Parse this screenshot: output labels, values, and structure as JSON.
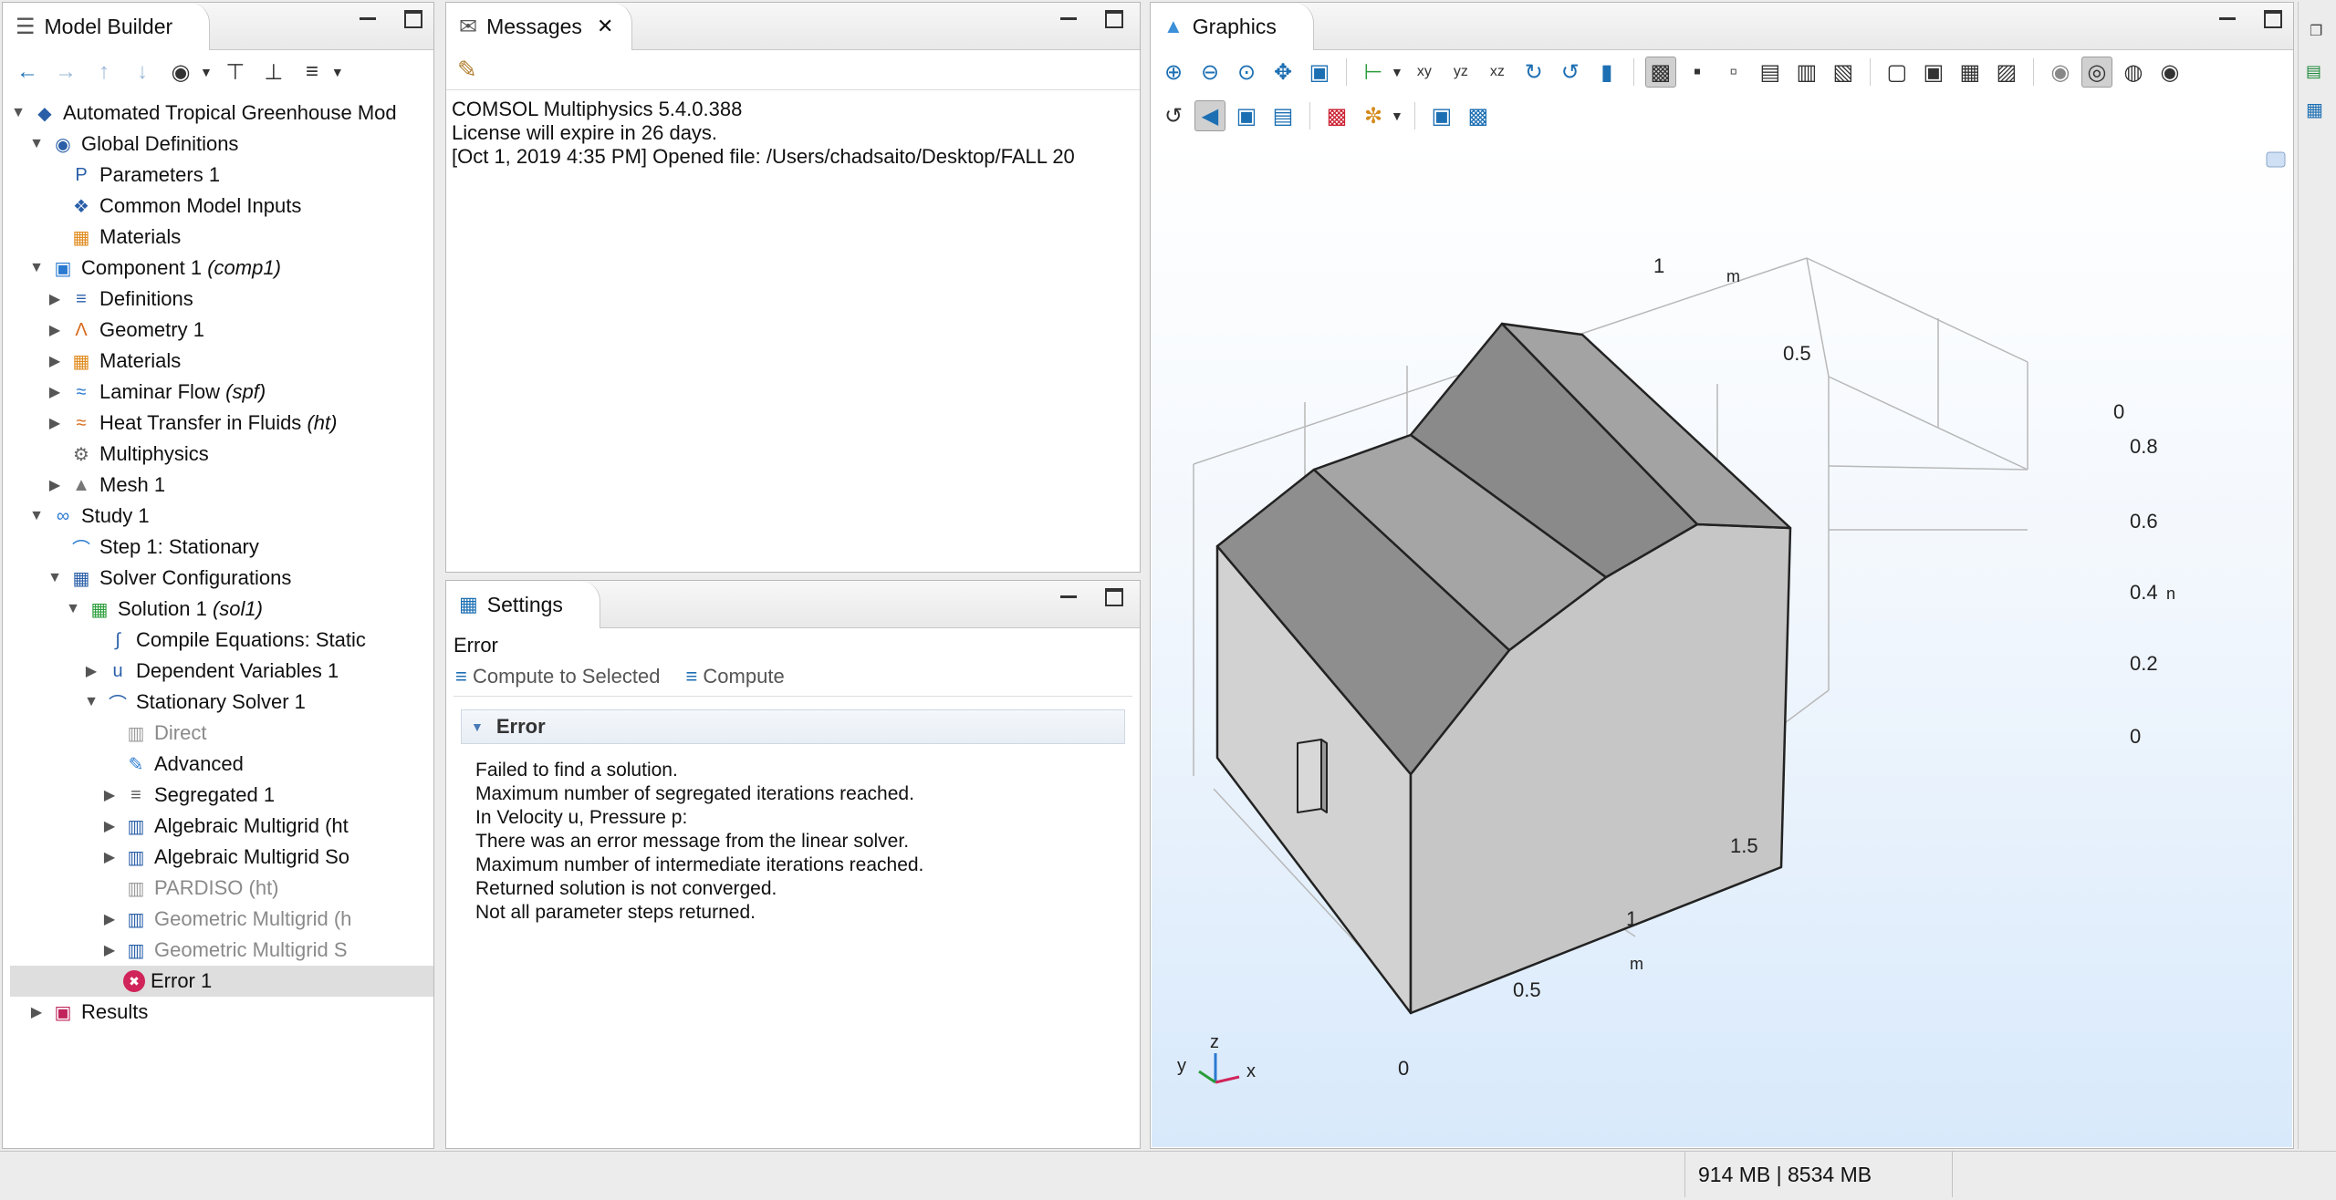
{
  "model_builder": {
    "title": "Model Builder",
    "toolbar_icons": [
      "back-icon",
      "forward-icon",
      "move-up-icon",
      "move-down-icon",
      "show-icon",
      "collapse-icon",
      "expand-icon",
      "list-icon"
    ],
    "tree": [
      {
        "label": "Automated Tropical Greenhouse Mod",
        "level": 0,
        "expanded": true,
        "icon": "model-icon"
      },
      {
        "label": "Global Definitions",
        "level": 1,
        "expanded": true,
        "icon": "globe-icon"
      },
      {
        "label": "Parameters 1",
        "level": 2,
        "icon": "parameters-icon"
      },
      {
        "label": "Common Model Inputs",
        "level": 2,
        "icon": "common-inputs-icon"
      },
      {
        "label": "Materials",
        "level": 2,
        "icon": "materials-icon"
      },
      {
        "label": "Component 1",
        "tag": "(comp1)",
        "level": 1,
        "expanded": true,
        "icon": "component-icon"
      },
      {
        "label": "Definitions",
        "level": 2,
        "collapsed": true,
        "icon": "definitions-icon"
      },
      {
        "label": "Geometry 1",
        "level": 2,
        "collapsed": true,
        "icon": "geometry-icon"
      },
      {
        "label": "Materials",
        "level": 2,
        "collapsed": true,
        "icon": "materials-icon"
      },
      {
        "label": "Laminar Flow",
        "tag": "(spf)",
        "level": 2,
        "collapsed": true,
        "icon": "laminar-flow-icon"
      },
      {
        "label": "Heat Transfer in Fluids",
        "tag": "(ht)",
        "level": 2,
        "collapsed": true,
        "icon": "heat-transfer-icon"
      },
      {
        "label": "Multiphysics",
        "level": 2,
        "icon": "multiphysics-icon"
      },
      {
        "label": "Mesh 1",
        "level": 2,
        "collapsed": true,
        "icon": "mesh-icon"
      },
      {
        "label": "Study 1",
        "level": 1,
        "expanded": true,
        "icon": "study-icon"
      },
      {
        "label": "Step 1: Stationary",
        "level": 2,
        "icon": "stationary-step-icon"
      },
      {
        "label": "Solver Configurations",
        "level": 2,
        "expanded": true,
        "icon": "solver-config-icon"
      },
      {
        "label": "Solution 1",
        "tag": "(sol1)",
        "level": 3,
        "expanded": true,
        "icon": "solution-icon"
      },
      {
        "label": "Compile Equations: Static",
        "level": 4,
        "icon": "compile-equations-icon"
      },
      {
        "label": "Dependent Variables 1",
        "level": 4,
        "collapsed": true,
        "icon": "dependent-variables-icon"
      },
      {
        "label": "Stationary Solver 1",
        "level": 4,
        "expanded": true,
        "icon": "stationary-solver-icon"
      },
      {
        "label": "Direct",
        "level": 5,
        "grey": true,
        "icon": "direct-icon"
      },
      {
        "label": "Advanced",
        "level": 5,
        "icon": "advanced-icon"
      },
      {
        "label": "Segregated 1",
        "level": 5,
        "collapsed": true,
        "icon": "segregated-icon"
      },
      {
        "label": "Algebraic Multigrid (ht",
        "level": 5,
        "collapsed": true,
        "icon": "multigrid-icon"
      },
      {
        "label": "Algebraic Multigrid So",
        "level": 5,
        "collapsed": true,
        "icon": "multigrid-icon"
      },
      {
        "label": "PARDISO (ht)",
        "level": 5,
        "grey": true,
        "icon": "pardiso-icon"
      },
      {
        "label": "Geometric Multigrid (h",
        "level": 5,
        "collapsed": true,
        "grey": true,
        "icon": "multigrid-icon"
      },
      {
        "label": "Geometric Multigrid S",
        "level": 5,
        "collapsed": true,
        "grey": true,
        "icon": "multigrid-icon"
      },
      {
        "label": "Error 1",
        "level": 5,
        "selected": true,
        "icon": "error-icon"
      },
      {
        "label": "Results",
        "level": 1,
        "collapsed": true,
        "icon": "results-icon"
      }
    ]
  },
  "messages": {
    "title": "Messages",
    "lines": [
      "COMSOL Multiphysics 5.4.0.388",
      "License will expire in 26 days.",
      "[Oct 1, 2019 4:35 PM] Opened file: /Users/chadsaito/Desktop/FALL 20"
    ]
  },
  "settings": {
    "title": "Settings",
    "node_label": "Error",
    "compute_selected": "Compute to Selected",
    "compute": "Compute",
    "section_title": "Error",
    "error_lines": [
      "Failed to find a solution.",
      "Maximum number of segregated iterations reached.",
      "In Velocity u, Pressure p:",
      "There was an error message from the linear solver.",
      "Maximum number of intermediate iterations reached.",
      "Returned solution is not converged.",
      "Not all parameter steps returned."
    ]
  },
  "graphics": {
    "title": "Graphics",
    "axis_labels": {
      "y_ticks": [
        "1",
        "0.5",
        "0"
      ],
      "z_ticks": [
        "0.8",
        "0.6",
        "0.4",
        "0.2",
        "0"
      ],
      "x_ticks": [
        "1.5",
        "1",
        "0.5",
        "0"
      ],
      "unit": "m",
      "unit_cut": "n"
    },
    "triad": {
      "x": "x",
      "y": "y",
      "z": "z"
    }
  },
  "status": {
    "memory": "914 MB | 8534 MB"
  },
  "colors": {
    "accent": "#1d6fb3",
    "error": "#d0245a",
    "roof_dark": "#8c8c8c",
    "roof_light": "#a6a6a6",
    "wall_front": "#d3d3d3",
    "wall_side": "#c3c3c3"
  }
}
